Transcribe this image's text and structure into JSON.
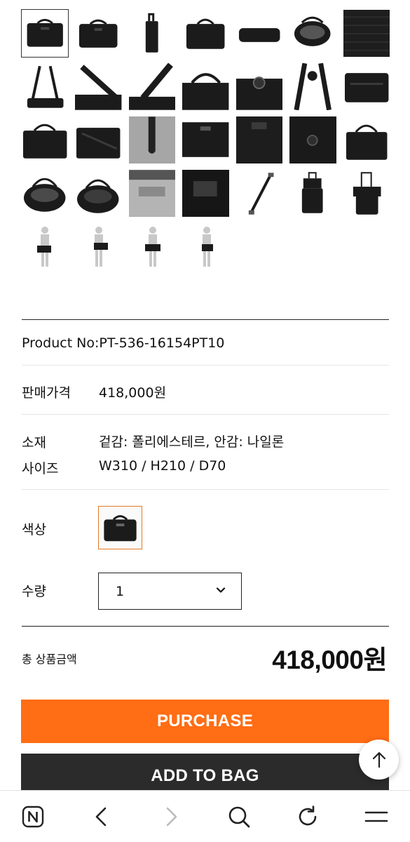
{
  "gallery": {
    "thumbnail_count": 32,
    "selected_index": 0
  },
  "product": {
    "product_no_label": "Product No:",
    "product_no": "PT-536-16154PT10",
    "price_label": "판매가격",
    "price": "418,000원",
    "material_label": "소재",
    "material": "겉감: 폴리에스테르, 안감: 나일론",
    "size_label": "사이즈",
    "size": "W310 / H210 / D70",
    "color_label": "색상",
    "quantity_label": "수량",
    "quantity": "1"
  },
  "total": {
    "label": "총 상품금액",
    "amount": "418,000원"
  },
  "buttons": {
    "purchase": "PURCHASE",
    "add_to_bag": "ADD TO BAG"
  },
  "colors": {
    "purchase_bg": "#ff6d14",
    "bag_bg": "#2b2b2b",
    "swatch_border": "#e27a28"
  },
  "browser_nav": {
    "icons": [
      "naver-home-icon",
      "back-arrow-icon",
      "forward-arrow-icon",
      "search-icon",
      "refresh-icon",
      "menu-icon"
    ]
  },
  "scroll_top_icon": "arrow-up-icon"
}
